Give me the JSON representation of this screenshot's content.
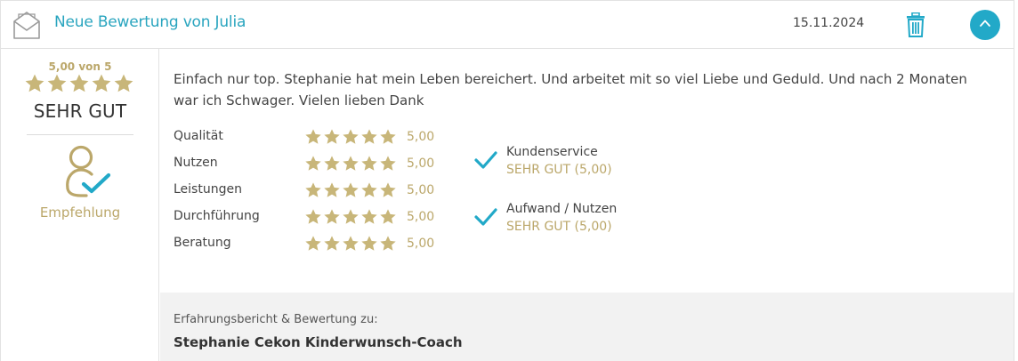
{
  "header": {
    "title": "Neue Bewertung von Julia",
    "date": "15.11.2024",
    "icons": {
      "mail": "envelope-open-icon",
      "delete": "trash-icon",
      "collapse": "chevron-up-icon"
    }
  },
  "summary": {
    "score_text": "5,00 von 5",
    "stars": 5,
    "verdict": "SEHR GUT",
    "recommendation_label": "Empfehlung"
  },
  "review": {
    "text": "Einfach nur top. Stephanie hat mein Leben bereichert. Und arbeitet mit so viel Liebe und Geduld. Und nach 2 Monaten war ich Schwager. Vielen lieben Dank"
  },
  "ratings": [
    {
      "label": "Qualität",
      "stars": 5,
      "value": "5,00"
    },
    {
      "label": "Nutzen",
      "stars": 5,
      "value": "5,00"
    },
    {
      "label": "Leistungen",
      "stars": 5,
      "value": "5,00"
    },
    {
      "label": "Durchführung",
      "stars": 5,
      "value": "5,00"
    },
    {
      "label": "Beratung",
      "stars": 5,
      "value": "5,00"
    }
  ],
  "highlights": [
    {
      "title": "Kundenservice",
      "value": "SEHR GUT (5,00)"
    },
    {
      "title": "Aufwand / Nutzen",
      "value": "SEHR GUT (5,00)"
    }
  ],
  "footer": {
    "label": "Erfahrungsbericht & Bewertung zu:",
    "name": "Stephanie Cekon Kinderwunsch-Coach"
  },
  "colors": {
    "accent": "#22a9c8",
    "gold": "#bba76a",
    "star": "#c8b679"
  }
}
